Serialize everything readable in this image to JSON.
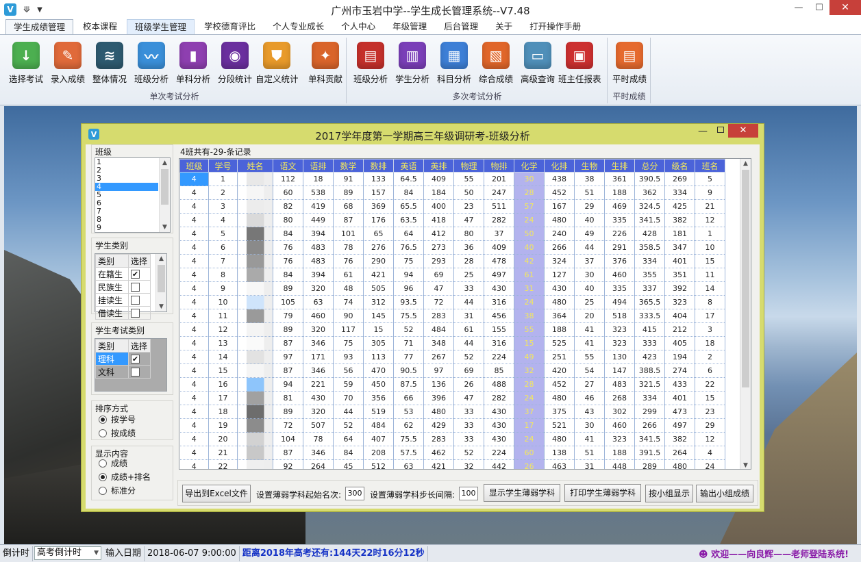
{
  "app": {
    "title": "广州市玉岩中学--学生成长管理系统--V7.48",
    "logo": "V"
  },
  "window_buttons": {
    "min": "—",
    "max": "☐",
    "close": "✕"
  },
  "tabs": [
    "学生成绩管理",
    "校本课程",
    "班级学生管理",
    "学校德育评比",
    "个人专业成长",
    "个人中心",
    "年级管理",
    "后台管理",
    "关于",
    "打开操作手册"
  ],
  "ribbon": {
    "groups": [
      {
        "label": "单次考试分析",
        "buttons": [
          {
            "label": "选择考试",
            "icon": "download-icon",
            "color": "#4caf50",
            "glyph": "↓"
          },
          {
            "label": "录入成绩",
            "icon": "pencil-notebook-icon",
            "color": "#e06a3a",
            "glyph": "✎"
          },
          {
            "label": "整体情况",
            "icon": "layers-icon",
            "color": "#2e5a70",
            "glyph": "≋"
          },
          {
            "label": "班级分析",
            "icon": "line-chart-icon",
            "color": "#3a8fd9",
            "glyph": "〰"
          },
          {
            "label": "单科分析",
            "icon": "bookmark-icon",
            "color": "#8e3fb0",
            "glyph": "▮"
          },
          {
            "label": "分段统计",
            "icon": "palette-icon",
            "color": "#6a2f9e",
            "glyph": "◉"
          },
          {
            "label": "自定义统计",
            "icon": "shield-icon",
            "color": "#e89a2a",
            "glyph": "⛊"
          },
          {
            "label": "单科贡献",
            "icon": "compass-icon",
            "color": "#d9642a",
            "glyph": "✦"
          }
        ]
      },
      {
        "label": "多次考试分析",
        "buttons": [
          {
            "label": "班级分析",
            "icon": "book-icon",
            "color": "#c4302b",
            "glyph": "▤"
          },
          {
            "label": "学生分析",
            "icon": "bar-chart-icon",
            "color": "#7a3fb8",
            "glyph": "▥"
          },
          {
            "label": "科目分析",
            "icon": "layout-icon",
            "color": "#3d7fd6",
            "glyph": "▦"
          },
          {
            "label": "综合成绩",
            "icon": "document-icon",
            "color": "#e0662a",
            "glyph": "▧"
          },
          {
            "label": "高级查询",
            "icon": "credit-card-icon",
            "color": "#4f8fb9",
            "glyph": "▭"
          },
          {
            "label": "班主任报表",
            "icon": "briefcase-icon",
            "color": "#cc3030",
            "glyph": "▣"
          }
        ]
      },
      {
        "label": "平时成绩",
        "buttons": [
          {
            "label": "平时成绩",
            "icon": "clipboard-icon",
            "color": "#e56a2e",
            "glyph": "▤"
          }
        ]
      }
    ]
  },
  "dialog": {
    "title": "2017学年度第一学期高三年级调研考-班级分析",
    "class_panel": {
      "label": "班级",
      "items": [
        "1",
        "2",
        "3",
        "4",
        "5",
        "6",
        "7",
        "8",
        "9"
      ],
      "selected": "4"
    },
    "student_type": {
      "label": "学生类别",
      "col1": "类别",
      "col2": "选择",
      "rows": [
        {
          "name": "在籍生",
          "checked": "✔"
        },
        {
          "name": "民族生",
          "checked": ""
        },
        {
          "name": "挂读生",
          "checked": ""
        },
        {
          "name": "借读生",
          "checked": ""
        }
      ]
    },
    "exam_type": {
      "label": "学生考试类别",
      "col1": "类别",
      "col2": "选择",
      "rows": [
        {
          "name": "理科",
          "checked": "✔"
        },
        {
          "name": "文科",
          "checked": ""
        }
      ]
    },
    "sort": {
      "label": "排序方式",
      "options": [
        "按学号",
        "按成绩"
      ],
      "selected": 0
    },
    "display": {
      "label": "显示内容",
      "options": [
        "成绩",
        "成绩+排名",
        "标准分"
      ],
      "selected": 1
    },
    "record_caption": "4班共有-29-条记录",
    "bottom": {
      "export_btn": "导出到Excel文件",
      "weak_start_label": "设置薄弱学科起始名次:",
      "weak_start_value": "300",
      "weak_step_label": "设置薄弱学科步长间隔:",
      "weak_step_value": "100",
      "show_weak_btn": "显示学生薄弱学科",
      "print_weak_btn": "打印学生薄弱学科",
      "group_show_btn": "按小组显示",
      "group_export_btn": "输出小组成绩"
    }
  },
  "table": {
    "headers": [
      "班级",
      "学号",
      "姓名",
      "语文",
      "语排",
      "数学",
      "数排",
      "英语",
      "英排",
      "物理",
      "物排",
      "化学",
      "化排",
      "生物",
      "生排",
      "总分",
      "级名",
      "班名"
    ],
    "rows": [
      [
        "4",
        "1",
        "",
        "112",
        "18",
        "91",
        "133",
        "64.5",
        "409",
        "55",
        "201",
        "30",
        "438",
        "38",
        "361",
        "390.5",
        "269",
        "5"
      ],
      [
        "4",
        "2",
        "",
        "60",
        "538",
        "89",
        "157",
        "84",
        "184",
        "50",
        "247",
        "28",
        "452",
        "51",
        "188",
        "362",
        "334",
        "9"
      ],
      [
        "4",
        "3",
        "",
        "82",
        "419",
        "68",
        "369",
        "65.5",
        "400",
        "23",
        "511",
        "57",
        "167",
        "29",
        "469",
        "324.5",
        "425",
        "21"
      ],
      [
        "4",
        "4",
        "",
        "80",
        "449",
        "87",
        "176",
        "63.5",
        "418",
        "47",
        "282",
        "24",
        "480",
        "40",
        "335",
        "341.5",
        "382",
        "12"
      ],
      [
        "4",
        "5",
        "",
        "84",
        "394",
        "101",
        "65",
        "64",
        "412",
        "80",
        "37",
        "50",
        "240",
        "49",
        "226",
        "428",
        "181",
        "1"
      ],
      [
        "4",
        "6",
        "",
        "76",
        "483",
        "78",
        "276",
        "76.5",
        "273",
        "36",
        "409",
        "40",
        "266",
        "44",
        "291",
        "358.5",
        "347",
        "10"
      ],
      [
        "4",
        "7",
        "",
        "76",
        "483",
        "76",
        "290",
        "75",
        "293",
        "28",
        "478",
        "42",
        "324",
        "37",
        "376",
        "334",
        "401",
        "15"
      ],
      [
        "4",
        "8",
        "",
        "84",
        "394",
        "61",
        "421",
        "94",
        "69",
        "25",
        "497",
        "61",
        "127",
        "30",
        "460",
        "355",
        "351",
        "11"
      ],
      [
        "4",
        "9",
        "",
        "89",
        "320",
        "48",
        "505",
        "96",
        "47",
        "33",
        "430",
        "31",
        "430",
        "40",
        "335",
        "337",
        "392",
        "14"
      ],
      [
        "4",
        "10",
        "",
        "105",
        "63",
        "74",
        "312",
        "93.5",
        "72",
        "44",
        "316",
        "24",
        "480",
        "25",
        "494",
        "365.5",
        "323",
        "8"
      ],
      [
        "4",
        "11",
        "",
        "79",
        "460",
        "90",
        "145",
        "75.5",
        "283",
        "31",
        "456",
        "38",
        "364",
        "20",
        "518",
        "333.5",
        "404",
        "17"
      ],
      [
        "4",
        "12",
        "",
        "89",
        "320",
        "117",
        "15",
        "52",
        "484",
        "61",
        "155",
        "55",
        "188",
        "41",
        "323",
        "415",
        "212",
        "3"
      ],
      [
        "4",
        "13",
        "",
        "87",
        "346",
        "75",
        "305",
        "71",
        "348",
        "44",
        "316",
        "15",
        "525",
        "41",
        "323",
        "333",
        "405",
        "18"
      ],
      [
        "4",
        "14",
        "",
        "97",
        "171",
        "93",
        "113",
        "77",
        "267",
        "52",
        "224",
        "49",
        "251",
        "55",
        "130",
        "423",
        "194",
        "2"
      ],
      [
        "4",
        "15",
        "",
        "87",
        "346",
        "56",
        "470",
        "90.5",
        "97",
        "69",
        "85",
        "32",
        "420",
        "54",
        "147",
        "388.5",
        "274",
        "6"
      ],
      [
        "4",
        "16",
        "",
        "94",
        "221",
        "59",
        "450",
        "87.5",
        "136",
        "26",
        "488",
        "28",
        "452",
        "27",
        "483",
        "321.5",
        "433",
        "22"
      ],
      [
        "4",
        "17",
        "",
        "81",
        "430",
        "70",
        "356",
        "66",
        "396",
        "47",
        "282",
        "24",
        "480",
        "46",
        "268",
        "334",
        "401",
        "15"
      ],
      [
        "4",
        "18",
        "",
        "89",
        "320",
        "44",
        "519",
        "53",
        "480",
        "33",
        "430",
        "37",
        "375",
        "43",
        "302",
        "299",
        "473",
        "23"
      ],
      [
        "4",
        "19",
        "",
        "72",
        "507",
        "52",
        "484",
        "62",
        "429",
        "33",
        "430",
        "17",
        "521",
        "30",
        "460",
        "266",
        "497",
        "29"
      ],
      [
        "4",
        "20",
        "",
        "104",
        "78",
        "64",
        "407",
        "75.5",
        "283",
        "33",
        "430",
        "24",
        "480",
        "41",
        "323",
        "341.5",
        "382",
        "12"
      ],
      [
        "4",
        "21",
        "",
        "87",
        "346",
        "84",
        "208",
        "57.5",
        "462",
        "52",
        "224",
        "60",
        "138",
        "51",
        "188",
        "391.5",
        "264",
        "4"
      ],
      [
        "4",
        "22",
        "",
        "92",
        "264",
        "45",
        "512",
        "63",
        "421",
        "32",
        "442",
        "26",
        "463",
        "31",
        "448",
        "289",
        "480",
        "24"
      ]
    ]
  },
  "status": {
    "countdown_label": "倒计时",
    "countdown_type": "高考倒计时",
    "date_label": "输入日期",
    "date_value": "2018-06-07  9:00:00",
    "remaining": "距离2018年高考还有:144天22时16分12秒",
    "welcome": "欢迎——向良辉——老师登陆系统!"
  },
  "colors": {
    "grid_header": "#4b63d9",
    "grid_header_text": "#f4e85c",
    "highlight_col": "#b3b3ee",
    "dialog_frame": "#d6db6e",
    "close_red": "#c7403a"
  }
}
